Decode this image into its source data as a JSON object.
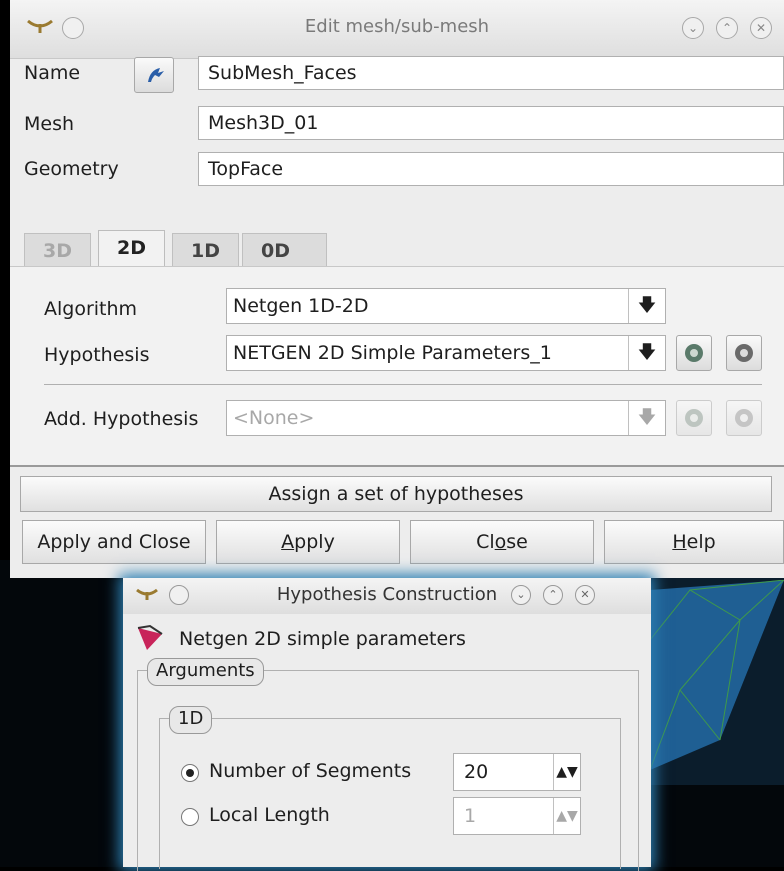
{
  "main_dialog": {
    "title": "Edit mesh/sub-mesh",
    "name_label": "Name",
    "name_value": "SubMesh_Faces",
    "mesh_label": "Mesh",
    "mesh_value": "Mesh3D_01",
    "geometry_label": "Geometry",
    "geometry_value": "TopFace",
    "tabs": [
      {
        "label": "3D",
        "state": "disabled"
      },
      {
        "label": "2D",
        "state": "active"
      },
      {
        "label": "1D",
        "state": "normal"
      },
      {
        "label": "0D",
        "state": "normal"
      }
    ],
    "algorithm_label": "Algorithm",
    "algorithm_value": "Netgen 1D-2D",
    "hypothesis_label": "Hypothesis",
    "hypothesis_value": "NETGEN 2D Simple Parameters_1",
    "add_hypothesis_label": "Add. Hypothesis",
    "add_hypothesis_value": "<None>",
    "assign_button": "Assign a set of hypotheses",
    "buttons": {
      "apply_and_close": "Apply and Close",
      "apply_prefix": "",
      "apply_u": "A",
      "apply_rest": "pply",
      "close_prefix": "Cl",
      "close_u": "o",
      "close_rest": "se",
      "help_prefix": "",
      "help_u": "H",
      "help_rest": "elp"
    }
  },
  "hypothesis_dialog": {
    "title": "Hypothesis Construction",
    "heading": "Netgen 2D simple parameters",
    "arguments_label": "Arguments",
    "group_1d_label": "1D",
    "num_segments_label": "Number of Segments",
    "num_segments_value": "20",
    "local_length_label": "Local Length",
    "local_length_value": "1"
  },
  "icons": {
    "window_menu": "antenna-menu-icon",
    "name_select": "arrow-select-icon",
    "edit_hyp": "hypothesis-edit-icon",
    "new_hyp": "hypothesis-create-icon",
    "netgen": "netgen-hypothesis-icon"
  },
  "colors": {
    "window_bg": "#ededed",
    "viewport_bg": "#03070b",
    "glow": "#2c7fb2",
    "mesh_blue": "#1f5f93"
  }
}
